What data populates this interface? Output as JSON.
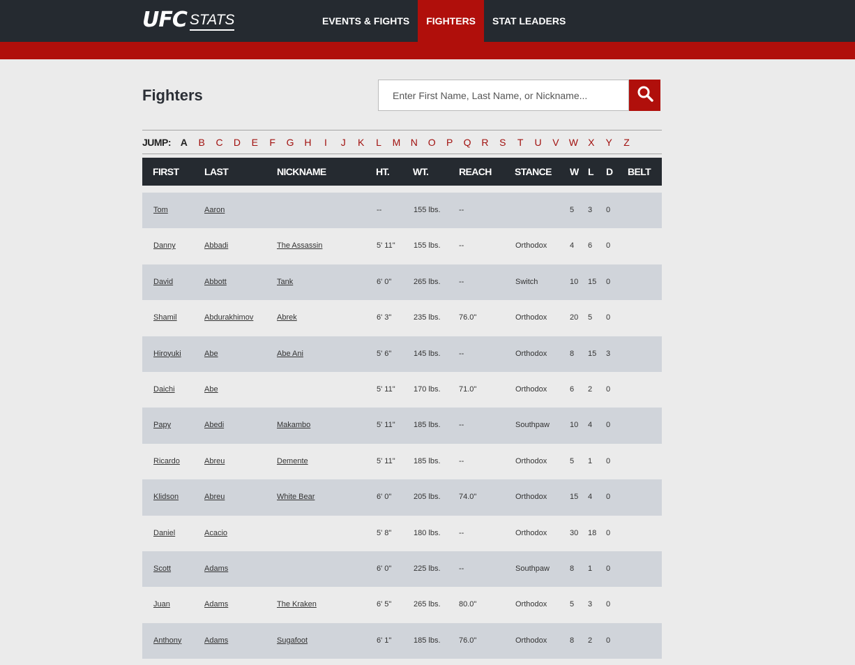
{
  "brand": {
    "logo_ufc": "UFC",
    "logo_stats": "STATS"
  },
  "nav": {
    "items": [
      "EVENTS & FIGHTS",
      "FIGHTERS",
      "STAT LEADERS"
    ],
    "active": "FIGHTERS"
  },
  "page_title": "Fighters",
  "search": {
    "placeholder": "Enter First Name, Last Name, or Nickname...",
    "icon": "search-icon"
  },
  "jump": {
    "label": "JUMP:",
    "current": "A",
    "letters": [
      "A",
      "B",
      "C",
      "D",
      "E",
      "F",
      "G",
      "H",
      "I",
      "J",
      "K",
      "L",
      "M",
      "N",
      "O",
      "P",
      "Q",
      "R",
      "S",
      "T",
      "U",
      "V",
      "W",
      "X",
      "Y",
      "Z"
    ]
  },
  "table": {
    "headers": [
      "FIRST",
      "LAST",
      "NICKNAME",
      "HT.",
      "WT.",
      "REACH",
      "STANCE",
      "W",
      "L",
      "D",
      "BELT"
    ],
    "rows": [
      {
        "first": "Tom",
        "last": "Aaron",
        "nickname": "",
        "ht": "--",
        "wt": "155 lbs.",
        "reach": "--",
        "stance": "",
        "w": "5",
        "l": "3",
        "d": "0",
        "belt": ""
      },
      {
        "first": "Danny",
        "last": "Abbadi",
        "nickname": "The Assassin",
        "ht": "5' 11\"",
        "wt": "155 lbs.",
        "reach": "--",
        "stance": "Orthodox",
        "w": "4",
        "l": "6",
        "d": "0",
        "belt": ""
      },
      {
        "first": "David",
        "last": "Abbott",
        "nickname": "Tank",
        "ht": "6' 0\"",
        "wt": "265 lbs.",
        "reach": "--",
        "stance": "Switch",
        "w": "10",
        "l": "15",
        "d": "0",
        "belt": ""
      },
      {
        "first": "Shamil",
        "last": "Abdurakhimov",
        "nickname": "Abrek",
        "ht": "6' 3\"",
        "wt": "235 lbs.",
        "reach": "76.0\"",
        "stance": "Orthodox",
        "w": "20",
        "l": "5",
        "d": "0",
        "belt": ""
      },
      {
        "first": "Hiroyuki",
        "last": "Abe",
        "nickname": "Abe Ani",
        "ht": "5' 6\"",
        "wt": "145 lbs.",
        "reach": "--",
        "stance": "Orthodox",
        "w": "8",
        "l": "15",
        "d": "3",
        "belt": ""
      },
      {
        "first": "Daichi",
        "last": "Abe",
        "nickname": "",
        "ht": "5' 11\"",
        "wt": "170 lbs.",
        "reach": "71.0\"",
        "stance": "Orthodox",
        "w": "6",
        "l": "2",
        "d": "0",
        "belt": ""
      },
      {
        "first": "Papy",
        "last": "Abedi",
        "nickname": "Makambo",
        "ht": "5' 11\"",
        "wt": "185 lbs.",
        "reach": "--",
        "stance": "Southpaw",
        "w": "10",
        "l": "4",
        "d": "0",
        "belt": ""
      },
      {
        "first": "Ricardo",
        "last": "Abreu",
        "nickname": "Demente",
        "ht": "5' 11\"",
        "wt": "185 lbs.",
        "reach": "--",
        "stance": "Orthodox",
        "w": "5",
        "l": "1",
        "d": "0",
        "belt": ""
      },
      {
        "first": "Klidson",
        "last": "Abreu",
        "nickname": "White Bear",
        "ht": "6' 0\"",
        "wt": "205 lbs.",
        "reach": "74.0\"",
        "stance": "Orthodox",
        "w": "15",
        "l": "4",
        "d": "0",
        "belt": ""
      },
      {
        "first": "Daniel",
        "last": "Acacio",
        "nickname": "",
        "ht": "5' 8\"",
        "wt": "180 lbs.",
        "reach": "--",
        "stance": "Orthodox",
        "w": "30",
        "l": "18",
        "d": "0",
        "belt": ""
      },
      {
        "first": "Scott",
        "last": "Adams",
        "nickname": "",
        "ht": "6' 0\"",
        "wt": "225 lbs.",
        "reach": "--",
        "stance": "Southpaw",
        "w": "8",
        "l": "1",
        "d": "0",
        "belt": ""
      },
      {
        "first": "Juan",
        "last": "Adams",
        "nickname": "The Kraken",
        "ht": "6' 5\"",
        "wt": "265 lbs.",
        "reach": "80.0\"",
        "stance": "Orthodox",
        "w": "5",
        "l": "3",
        "d": "0",
        "belt": ""
      },
      {
        "first": "Anthony",
        "last": "Adams",
        "nickname": "Sugafoot",
        "ht": "6' 1\"",
        "wt": "185 lbs.",
        "reach": "76.0\"",
        "stance": "Orthodox",
        "w": "8",
        "l": "2",
        "d": "0",
        "belt": ""
      }
    ]
  },
  "colors": {
    "nav_bg": "#252a30",
    "accent_red": "#b00f0b",
    "page_bg": "#ebebeb",
    "row_alt": "#d0d4da"
  }
}
